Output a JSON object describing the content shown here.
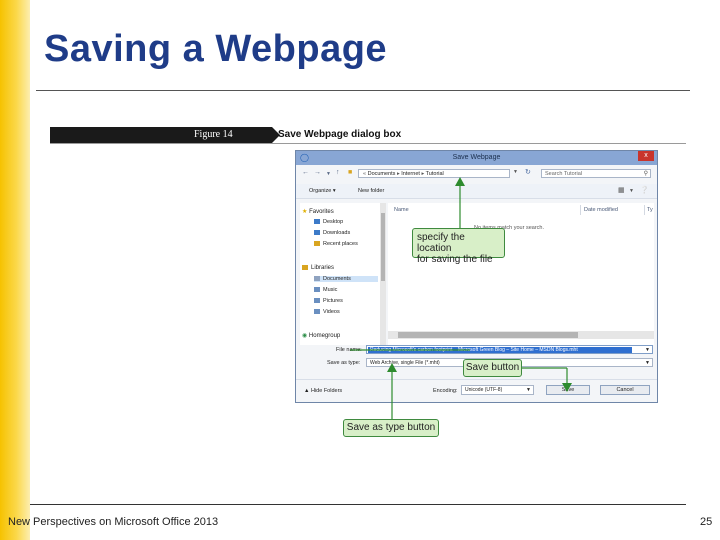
{
  "slide": {
    "title": "Saving a Webpage",
    "footer_text": "New Perspectives on Microsoft Office 2013",
    "page_number": "25",
    "accent_color": "#f6c200",
    "title_color": "#1f3c88"
  },
  "figure": {
    "label": "Figure 14",
    "caption": "Save Webpage dialog box"
  },
  "dialog": {
    "title": "Save Webpage",
    "close_label": "x",
    "breadcrumb": [
      "Documents",
      "Internet",
      "Tutorial"
    ],
    "search_placeholder": "Search Tutorial",
    "toolbar": {
      "organize": "Organize",
      "new_folder": "New folder"
    },
    "nav": {
      "favorites_head": "Favorites",
      "favorites": [
        "Desktop",
        "Downloads",
        "Recent places"
      ],
      "libraries_head": "Libraries",
      "libraries": [
        "Documents",
        "Music",
        "Pictures",
        "Videos"
      ],
      "homegroup": "Homegroup"
    },
    "columns": {
      "name": "Name",
      "date_modified": "Date modified",
      "type": "Ty"
    },
    "empty_message": "No items match your search.",
    "file_name_label": "File name:",
    "file_name_value": "Reducing Microsoft's carbon footprint – Microsoft Green Blog – Site Home – MSDN Blogs.mht",
    "save_as_type_label": "Save as type:",
    "save_as_type_value": "Web Archive, single File (*.mht)",
    "hide_folders": "Hide Folders",
    "encoding_label": "Encoding:",
    "encoding_value": "Unicode (UTF-8)",
    "save_button": "Save",
    "cancel_button": "Cancel"
  },
  "callouts": {
    "location_line1": "specify the location",
    "location_line2": "for saving the file",
    "save_button": "Save button",
    "save_as_type_button": "Save as type button"
  }
}
